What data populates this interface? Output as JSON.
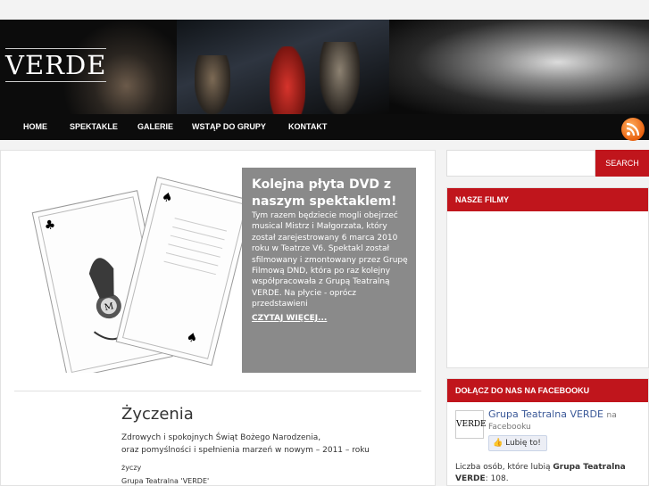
{
  "site": {
    "logo": "VERDE"
  },
  "nav": {
    "items": [
      "HOME",
      "SPEKTAKLE",
      "GALERIE",
      "WSTĄP DO GRUPY",
      "KONTAKT"
    ]
  },
  "slider": {
    "title": "Kolejna płyta DVD z naszym spektaklem!",
    "text": "Tym razem będziecie mogli obejrzeć musical Mistrz i Małgorzata, który został zarejestrowany 6 marca 2010 roku w Teatrze V6. Spektakl został sfilmowany i zmontowany przez Grupę Filmową DND, która po raz kolejny współpracowała z Grupą Teatralną VERDE. Na płycie - oprócz przedstawieni",
    "more": "CZYTAJ WIĘCEJ...",
    "card_text": "Mistrz i Małgorzata"
  },
  "post": {
    "title": "Życzenia",
    "line1": "Zdrowych i spokojnych Świąt Bożego Narodzenia,",
    "line2": "oraz pomyślności i spełnienia marzeń w nowym – 2011 – roku",
    "line3": "życzy",
    "line4": "Grupa Teatralna 'VERDE'"
  },
  "sidebar": {
    "search_button": "SEARCH",
    "films_title": "NASZE FILMY",
    "facebook_title": "DOŁĄCZ DO NAS NA FACEBOOKU",
    "fb_page": "Grupa Teatralna VERDE",
    "fb_on": "na",
    "fb_site": "Facebooku",
    "fb_like": "Lubię to!",
    "fb_count_prefix": "Liczba osób, które lubią",
    "fb_count_name": "Grupa Teatralna VERDE",
    "fb_count_value": ": 108."
  },
  "colors": {
    "accent": "#c0151c",
    "nav_bg": "#0c0c0c",
    "caption_bg": "#8a8a8a"
  }
}
